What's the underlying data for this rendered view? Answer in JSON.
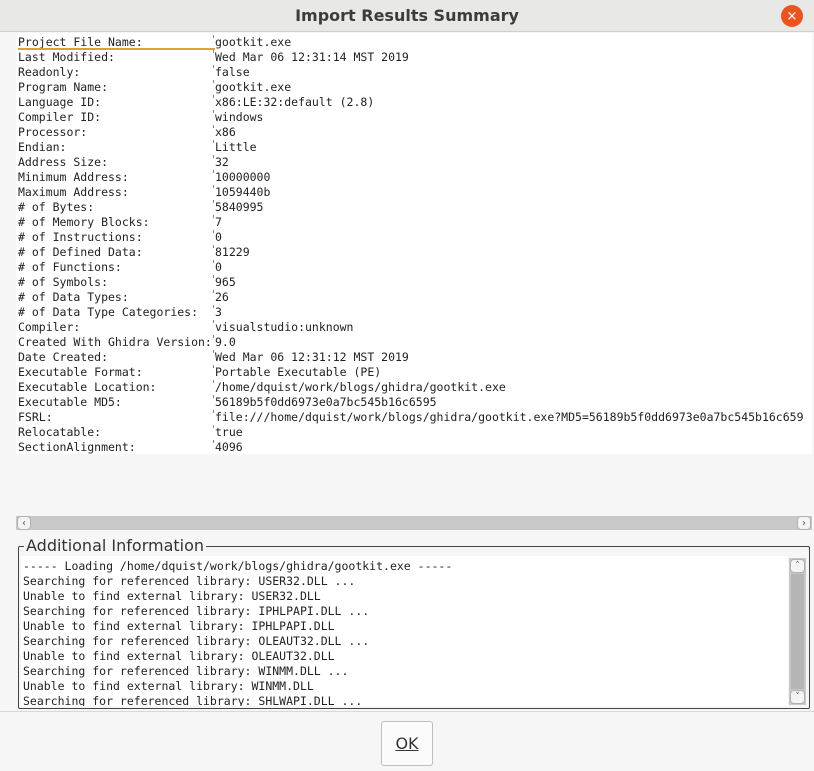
{
  "window": {
    "title": "Import Results Summary",
    "close_glyph": "×"
  },
  "properties": [
    {
      "key": "Project File Name:",
      "value": "gootkit.exe"
    },
    {
      "key": "Last Modified:",
      "value": "Wed Mar 06 12:31:14 MST 2019"
    },
    {
      "key": "Readonly:",
      "value": "false"
    },
    {
      "key": "Program Name:",
      "value": "gootkit.exe"
    },
    {
      "key": "Language ID:",
      "value": "x86:LE:32:default (2.8)"
    },
    {
      "key": "Compiler ID:",
      "value": "windows"
    },
    {
      "key": "Processor:",
      "value": "x86"
    },
    {
      "key": "Endian:",
      "value": "Little"
    },
    {
      "key": "Address Size:",
      "value": "32"
    },
    {
      "key": "Minimum Address:",
      "value": "10000000"
    },
    {
      "key": "Maximum Address:",
      "value": "1059440b"
    },
    {
      "key": "# of Bytes:",
      "value": "5840995"
    },
    {
      "key": "# of Memory Blocks:",
      "value": "7"
    },
    {
      "key": "# of Instructions:",
      "value": "0"
    },
    {
      "key": "# of Defined Data:",
      "value": "81229"
    },
    {
      "key": "# of Functions:",
      "value": "0"
    },
    {
      "key": "# of Symbols:",
      "value": "965"
    },
    {
      "key": "# of Data Types:",
      "value": "26"
    },
    {
      "key": "# of Data Type Categories:",
      "value": "3"
    },
    {
      "key": "Compiler:",
      "value": "visualstudio:unknown"
    },
    {
      "key": "Created With Ghidra Version:",
      "value": "9.0"
    },
    {
      "key": "Date Created:",
      "value": "Wed Mar 06 12:31:12 MST 2019"
    },
    {
      "key": "Executable Format:",
      "value": "Portable Executable (PE)"
    },
    {
      "key": "Executable Location:",
      "value": "/home/dquist/work/blogs/ghidra/gootkit.exe"
    },
    {
      "key": "Executable MD5:",
      "value": "56189b5f0dd6973e0a7bc545b16c6595"
    },
    {
      "key": "FSRL:",
      "value": "file:///home/dquist/work/blogs/ghidra/gootkit.exe?MD5=56189b5f0dd6973e0a7bc545b16c659"
    },
    {
      "key": "Relocatable:",
      "value": "true"
    },
    {
      "key": "SectionAlignment:",
      "value": "4096"
    }
  ],
  "scroll_left_glyph": "‹",
  "scroll_right_glyph": "›",
  "scroll_up_glyph": "˄",
  "scroll_down_glyph": "˅",
  "additional_info": {
    "title": "Additional Information",
    "lines": [
      "----- Loading /home/dquist/work/blogs/ghidra/gootkit.exe -----",
      "Searching for referenced library: USER32.DLL ...",
      "Unable to find external library: USER32.DLL",
      "Searching for referenced library: IPHLPAPI.DLL ...",
      "Unable to find external library: IPHLPAPI.DLL",
      "Searching for referenced library: OLEAUT32.DLL ...",
      "Unable to find external library: OLEAUT32.DLL",
      "Searching for referenced library: WINMM.DLL ...",
      "Unable to find external library: WINMM.DLL",
      "Searching for referenced library: SHLWAPI.DLL ..."
    ]
  },
  "ok_label": "OK",
  "colors": {
    "close_button": "#e95420",
    "focus_underline": "#e0a030"
  }
}
